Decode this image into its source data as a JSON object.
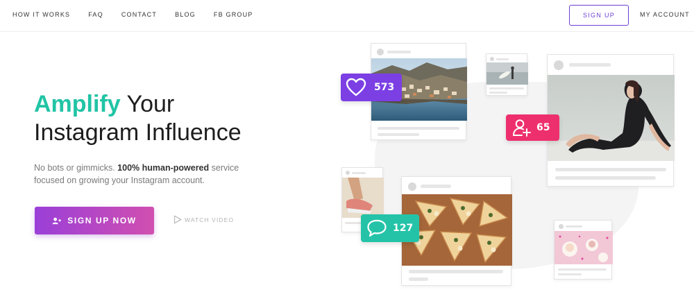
{
  "nav": {
    "links": [
      "HOW IT WORKS",
      "FAQ",
      "CONTACT",
      "BLOG",
      "FB GROUP"
    ],
    "signup": "SIGN UP",
    "account": "MY ACCOUNT"
  },
  "hero": {
    "title_accent": "Amplify",
    "title_rest_line1": "Your",
    "title_line2": "Instagram Influence",
    "sub_part1": "No bots or gimmicks. ",
    "sub_bold": "100% human-powered",
    "sub_part2": " service focused on growing your Instagram account.",
    "cta_label": "SIGN UP NOW",
    "watch_label": "WATCH VIDEO"
  },
  "badges": {
    "likes": "573",
    "followers": "65",
    "comments": "127"
  },
  "colors": {
    "accent_teal": "#21c4a5",
    "purple": "#6b3fd3",
    "like_badge": "#7b3fe4",
    "follower_badge": "#ee2f6e",
    "comment_badge": "#24c3a8"
  },
  "icons": [
    "user-plus-icon",
    "play-icon",
    "heart-icon",
    "add-user-icon",
    "speech-bubble-icon"
  ]
}
